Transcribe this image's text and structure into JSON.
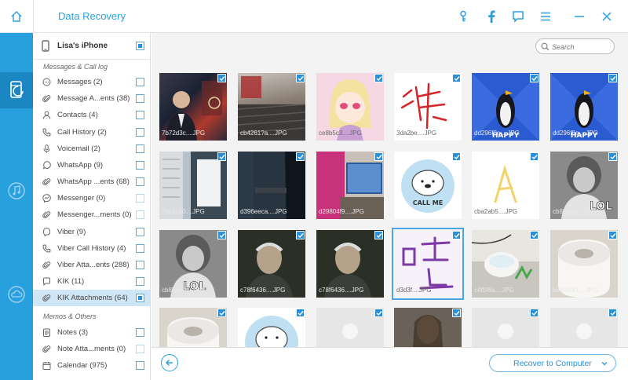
{
  "app": {
    "title": "Data Recovery"
  },
  "device": {
    "name": "Lisa's iPhone"
  },
  "sections": [
    {
      "label": "Messages & Call log"
    },
    {
      "label": "Memos & Others"
    }
  ],
  "categories": [
    {
      "label": "Messages (2)",
      "icon": "message-bubble-icon"
    },
    {
      "label": "Message A...ents (38)",
      "icon": "paperclip-icon"
    },
    {
      "label": "Contacts (4)",
      "icon": "person-icon"
    },
    {
      "label": "Call History (2)",
      "icon": "phone-icon"
    },
    {
      "label": "Voicemail (2)",
      "icon": "microphone-icon"
    },
    {
      "label": "WhatsApp (9)",
      "icon": "whatsapp-icon"
    },
    {
      "label": "WhatsApp ...ents (68)",
      "icon": "paperclip-icon"
    },
    {
      "label": "Messenger (0)",
      "icon": "messenger-icon"
    },
    {
      "label": "Messenger...ments (0)",
      "icon": "paperclip-icon"
    },
    {
      "label": "Viber (9)",
      "icon": "viber-icon"
    },
    {
      "label": "Viber Call History (4)",
      "icon": "phone-icon"
    },
    {
      "label": "Viber Atta...ents (288)",
      "icon": "paperclip-icon"
    },
    {
      "label": "KIK (11)",
      "icon": "kik-icon"
    },
    {
      "label": "KIK Attachments (64)",
      "icon": "paperclip-icon"
    },
    {
      "label": "Notes (3)",
      "icon": "notes-icon"
    },
    {
      "label": "Note Atta...ments (0)",
      "icon": "paperclip-icon"
    },
    {
      "label": "Calendar (975)",
      "icon": "calendar-icon"
    }
  ],
  "search": {
    "placeholder": "Search"
  },
  "thumbnails": [
    {
      "name": "7b72d3c....JPG"
    },
    {
      "name": "cb4261?a....JPG"
    },
    {
      "name": "ce8b5c3....JPG"
    },
    {
      "name": "3da2be....JPG"
    },
    {
      "name": "dd296f8e....JPG"
    },
    {
      "name": "dd296f8e....JPG"
    },
    {
      "name": "7ce2c40....JPG"
    },
    {
      "name": "d396eeca....JPG"
    },
    {
      "name": "d29804f9....JPG"
    },
    {
      "name": ""
    },
    {
      "name": "cba2ab5....JPG"
    },
    {
      "name": "cb8b09b....JPG"
    },
    {
      "name": "cb8b09b....JPG"
    },
    {
      "name": "c78f6436....JPG"
    },
    {
      "name": "c78f6436....JPG"
    },
    {
      "name": "d3d3f....JPG"
    },
    {
      "name": "c4f5f6a....JPG"
    },
    {
      "name": "bd49d0f1....JPG"
    },
    {
      "name": ""
    },
    {
      "name": ""
    },
    {
      "name": ""
    },
    {
      "name": ""
    },
    {
      "name": ""
    },
    {
      "name": ""
    }
  ],
  "bottom": {
    "recover_label": "Recover to Computer"
  },
  "colors": {
    "accent": "#27a0dd",
    "accent_dark": "#1a86c2",
    "check": "#2a8fd6"
  }
}
